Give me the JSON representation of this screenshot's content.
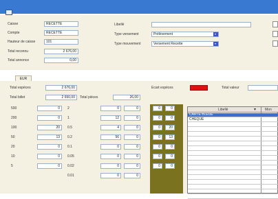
{
  "header": {
    "caisse_label": "Caisse",
    "caisse_value": "RECETTE",
    "compte_label": "Compte",
    "compte_value": "RECETTE",
    "hauteur_label": "Hauteur de caisse",
    "hauteur_value": "101",
    "total_reconnu_label": "Total reconnu",
    "total_reconnu_value": "2 676,00",
    "total_annonce_label": "Total annonce",
    "total_annonce_value": "0,00",
    "libelle_label": "Libellé",
    "libelle_value": "",
    "type_versement_label": "Type versement",
    "type_versement_value": "Prélèvement",
    "type_mouvement_label": "Type mouvement",
    "type_mouvement_value": "Versement Recette"
  },
  "tabs": [
    {
      "label": "EUR"
    }
  ],
  "totals": {
    "especes_label": "Total espèces",
    "especes_value": "2 676,00",
    "billet_label": "Total billet",
    "billet_value": "2 650,00",
    "pieces_label": "Total pièces",
    "pieces_value": "26,00",
    "ecart_label": "Ecart espèces",
    "valeur_label": "Total valeur"
  },
  "billets": [
    {
      "denom": "500",
      "count": "0"
    },
    {
      "denom": "200",
      "count": "0"
    },
    {
      "denom": "100",
      "count": "20"
    },
    {
      "denom": "50",
      "count": "13"
    },
    {
      "denom": "20",
      "count": "0"
    },
    {
      "denom": "10",
      "count": "0"
    },
    {
      "denom": "5",
      "count": "0"
    }
  ],
  "pieces": [
    {
      "denom": "2",
      "count": "0"
    },
    {
      "denom": "1",
      "count": "12"
    },
    {
      "denom": "0.5",
      "count": "4"
    },
    {
      "denom": "0.2",
      "count": "56"
    },
    {
      "denom": "0.1",
      "count": "0"
    },
    {
      "denom": "0.05",
      "count": "0"
    },
    {
      "denom": "0.02",
      "count": "0"
    },
    {
      "denom": "0.01",
      "count": "0"
    }
  ],
  "amounts": [
    "0",
    "0",
    "0",
    "0",
    "0",
    "0",
    "0",
    "0"
  ],
  "olive_cols": [
    [
      "0",
      "0",
      "0",
      "0",
      "0",
      "0",
      "0"
    ],
    [
      "0",
      "0",
      "20",
      "13",
      "0",
      "0",
      "0"
    ]
  ],
  "grid": {
    "header_label": "Libellé",
    "header_mon": "Mon",
    "rows": [
      {
        "label": "CARTE BLEUE"
      },
      {
        "label": "CHEQUE"
      }
    ]
  },
  "colors": {
    "titlebar": "#3a79d2",
    "olive": "#7b7220",
    "ecart_red": "#e01010",
    "selection": "#3a6fd0"
  }
}
